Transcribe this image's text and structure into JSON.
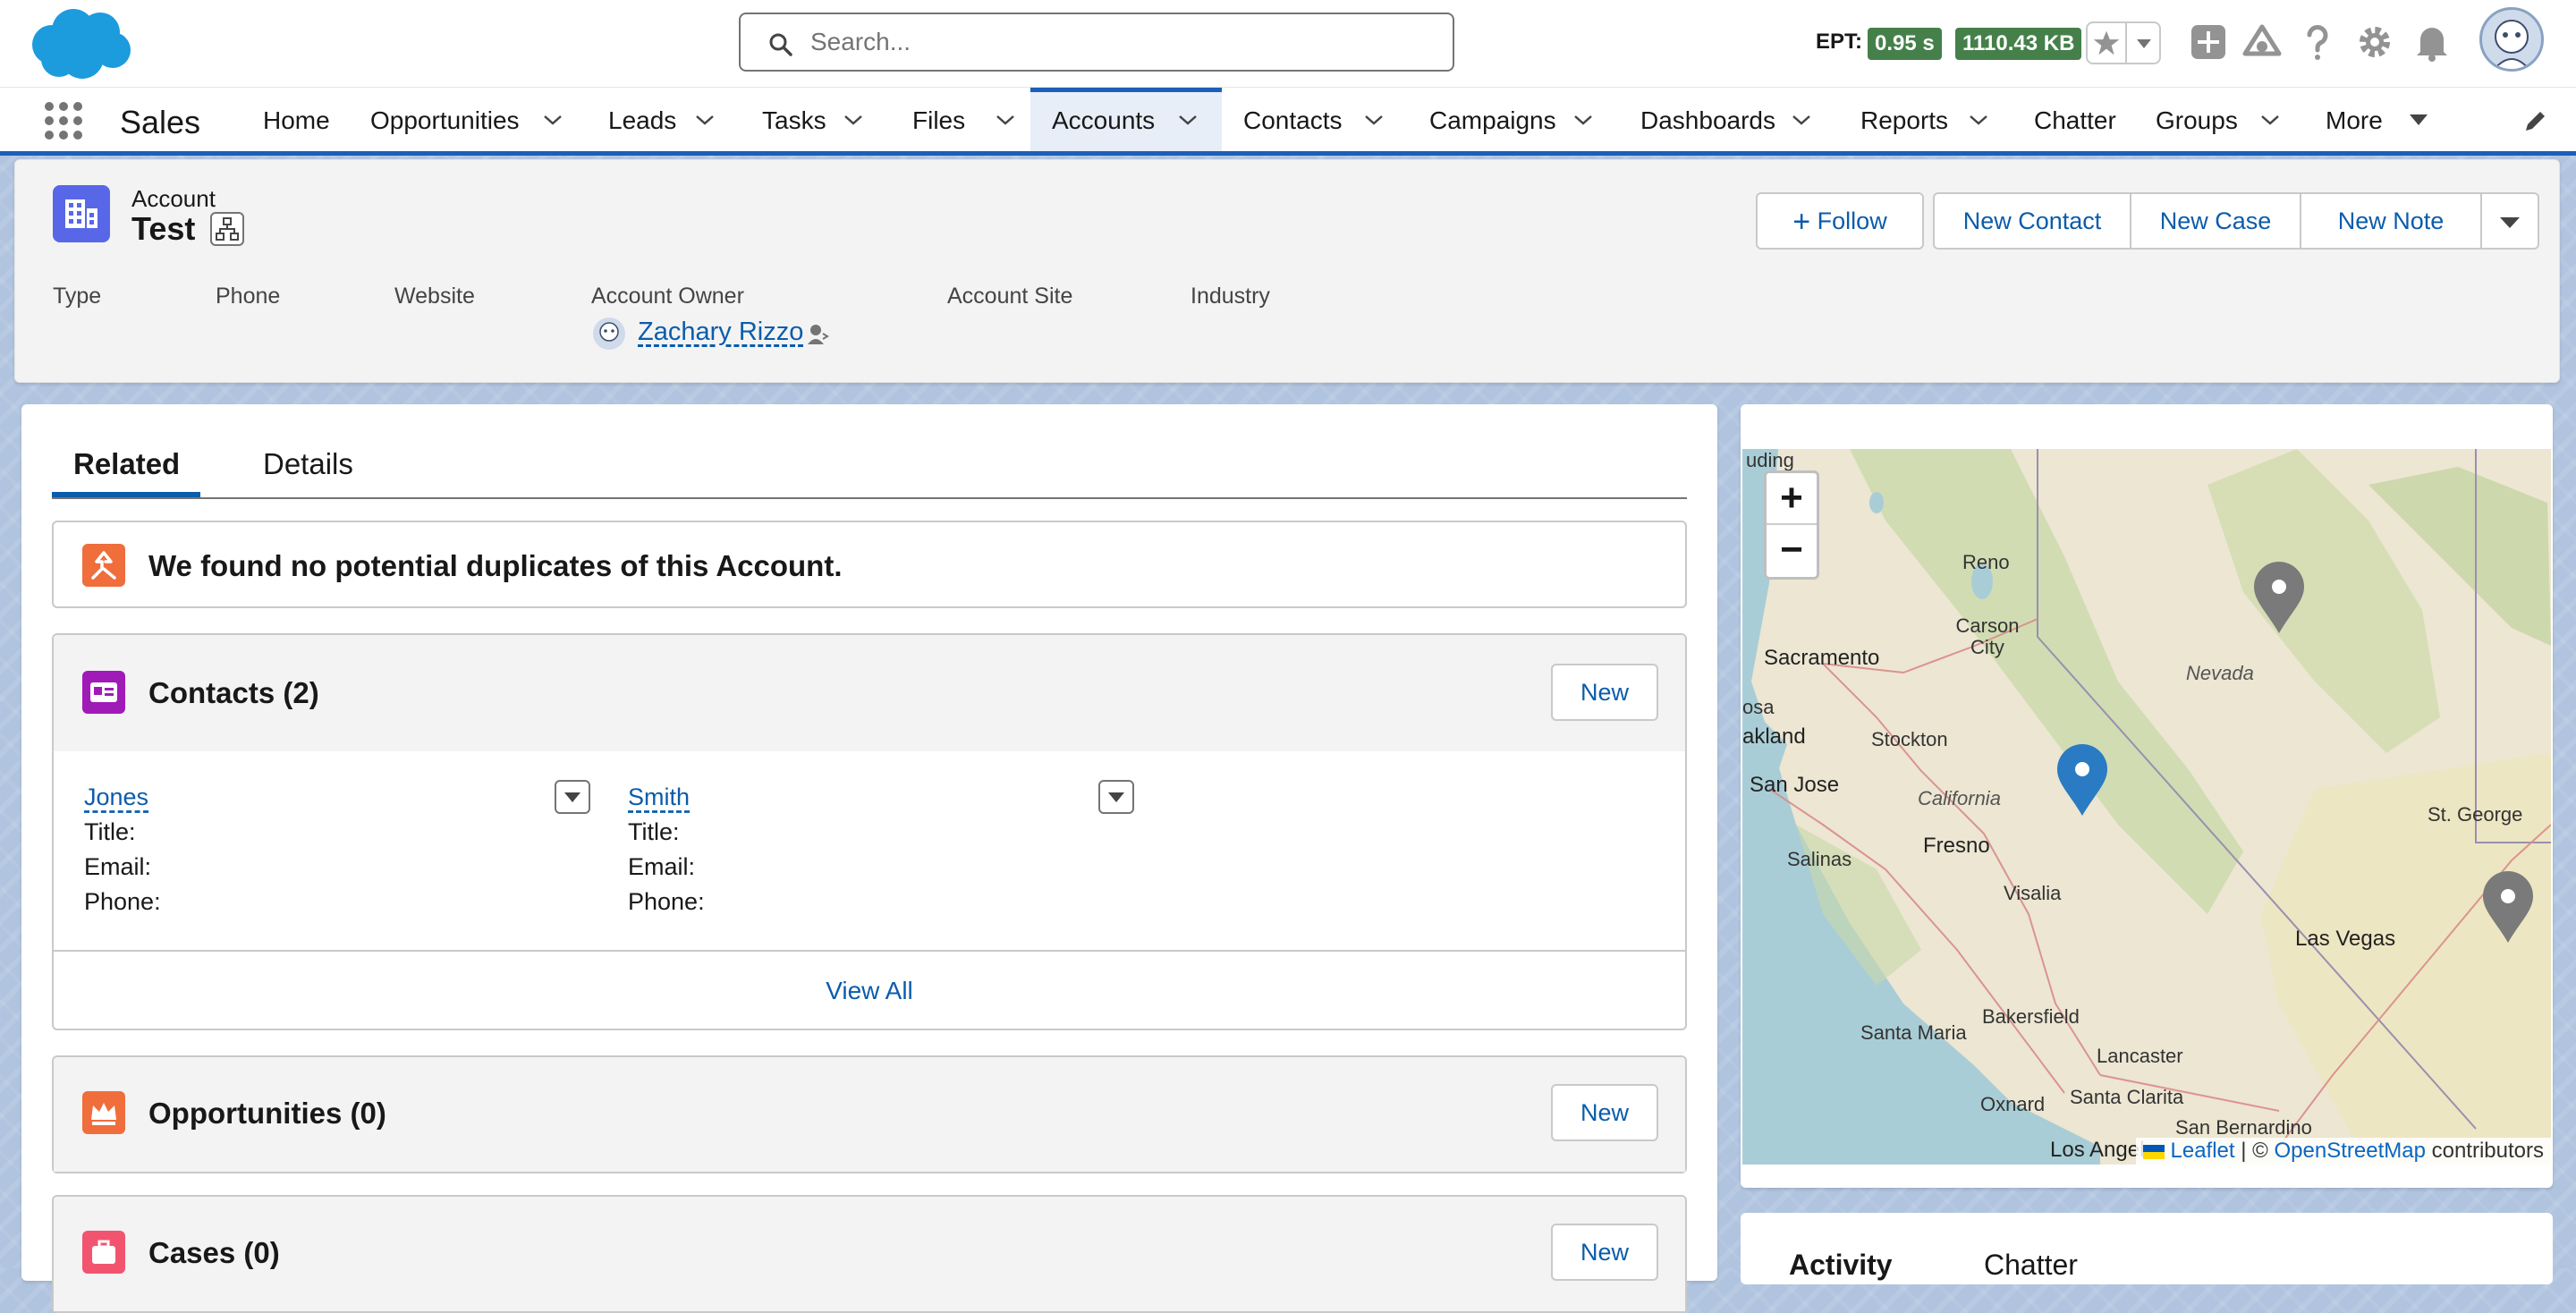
{
  "header": {
    "search_placeholder": "Search...",
    "ept_label": "EPT:",
    "ept_time": "0.95 s",
    "ept_size": "1110.43 KB",
    "icons": [
      "cloud-logo",
      "search-icon",
      "star-icon",
      "chevron-down-icon",
      "add-icon",
      "trailhead-icon",
      "help-icon",
      "gear-icon",
      "bell-icon",
      "avatar"
    ]
  },
  "nav": {
    "app_name": "Sales",
    "items": [
      "Home",
      "Opportunities",
      "Leads",
      "Tasks",
      "Files",
      "Accounts",
      "Contacts",
      "Campaigns",
      "Dashboards",
      "Reports",
      "Chatter",
      "Groups",
      "More"
    ],
    "active": "Accounts"
  },
  "record": {
    "object_type": "Account",
    "title": "Test",
    "actions": {
      "follow": "Follow",
      "new_contact": "New Contact",
      "new_case": "New Case",
      "new_note": "New Note"
    },
    "fields": {
      "type": "Type",
      "phone": "Phone",
      "website": "Website",
      "owner": "Account Owner",
      "site": "Account Site",
      "industry": "Industry",
      "owner_name": "Zachary Rizzo"
    }
  },
  "main": {
    "tabs": {
      "related": "Related",
      "details": "Details"
    },
    "duplicates": "We found no potential duplicates of this Account.",
    "contacts": {
      "title": "Contacts (2)",
      "new": "New",
      "view_all": "View All",
      "items": [
        {
          "name": "Jones",
          "title": "Title:",
          "email": "Email:",
          "phone": "Phone:"
        },
        {
          "name": "Smith",
          "title": "Title:",
          "email": "Email:",
          "phone": "Phone:"
        }
      ]
    },
    "opportunities": {
      "title": "Opportunities (0)",
      "new": "New"
    },
    "cases": {
      "title": "Cases (0)",
      "new": "New"
    }
  },
  "map": {
    "zoom_in": "+",
    "zoom_out": "−",
    "labels": [
      "Reno",
      "Carson City",
      "Sacramento",
      "Nevada",
      "Stockton",
      "akland",
      "San Jose",
      "California",
      "Fresno",
      "Visalia",
      "Salinas",
      "St. George",
      "Las Vegas",
      "Bakersfield",
      "Santa Maria",
      "Lancaster",
      "Santa Clarita",
      "Oxnard",
      "San Bernardino",
      "Los Angel",
      "osa",
      "uding"
    ],
    "attribution": {
      "leaflet": "Leaflet",
      "sep": "| ©",
      "osm": "OpenStreetMap",
      "contrib": "contributors"
    }
  },
  "side": {
    "activity": "Activity",
    "chatter": "Chatter"
  },
  "colors": {
    "brand_blue": "#0b5cab",
    "nav_active": "#1b5fb9",
    "account_icon": "#5867e8",
    "contacts_icon": "#a01ab8",
    "opp_icon": "#ef6e3c",
    "cases_icon": "#f2546f",
    "badge_green": "#45804a"
  }
}
